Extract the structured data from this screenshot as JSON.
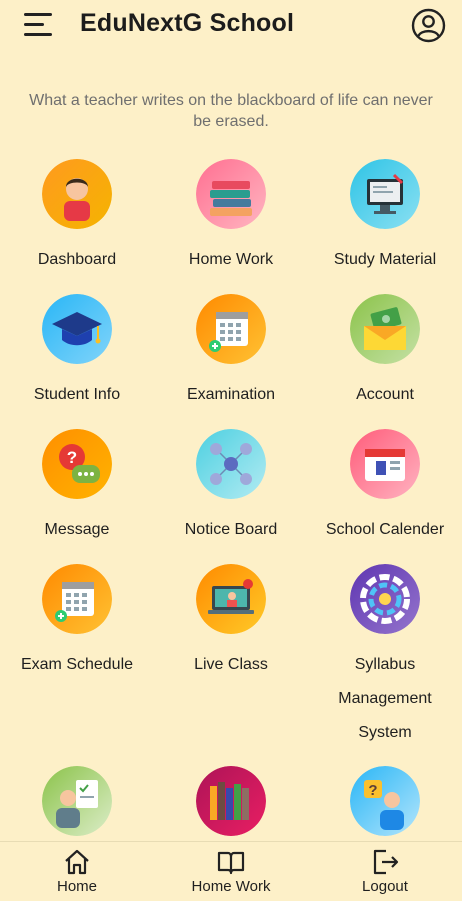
{
  "header": {
    "title": "EduNextG School",
    "menu_icon": "hamburger-menu-icon",
    "profile_icon": "user-circle-icon"
  },
  "quote": "What a teacher writes on the blackboard of life can never be erased.",
  "tiles": [
    {
      "label": "Dashboard",
      "icon": "student-avatar-icon"
    },
    {
      "label": "Home Work",
      "icon": "books-stack-icon"
    },
    {
      "label": "Study Material",
      "icon": "computer-study-icon"
    },
    {
      "label": "Student Info",
      "icon": "graduation-cap-icon"
    },
    {
      "label": "Examination",
      "icon": "calendar-add-icon"
    },
    {
      "label": "Account",
      "icon": "money-envelope-icon"
    },
    {
      "label": "Message",
      "icon": "chat-question-icon"
    },
    {
      "label": "Notice Board",
      "icon": "network-people-icon"
    },
    {
      "label": "School Calender",
      "icon": "calendar-board-icon"
    },
    {
      "label": "Exam Schedule",
      "icon": "calendar-add-icon"
    },
    {
      "label": "Live Class",
      "icon": "laptop-teacher-icon"
    },
    {
      "label": "Syllabus Management System",
      "icon": "radial-chart-icon"
    },
    {
      "label": "",
      "icon": "teacher-checklist-icon"
    },
    {
      "label": "",
      "icon": "library-books-icon"
    },
    {
      "label": "",
      "icon": "question-person-icon"
    }
  ],
  "bottom_nav": {
    "home": "Home",
    "homework": "Home Work",
    "logout": "Logout"
  },
  "colors": {
    "background": "#fdf0c8",
    "text": "#1f1f1f",
    "quote": "#6f6f6f"
  }
}
